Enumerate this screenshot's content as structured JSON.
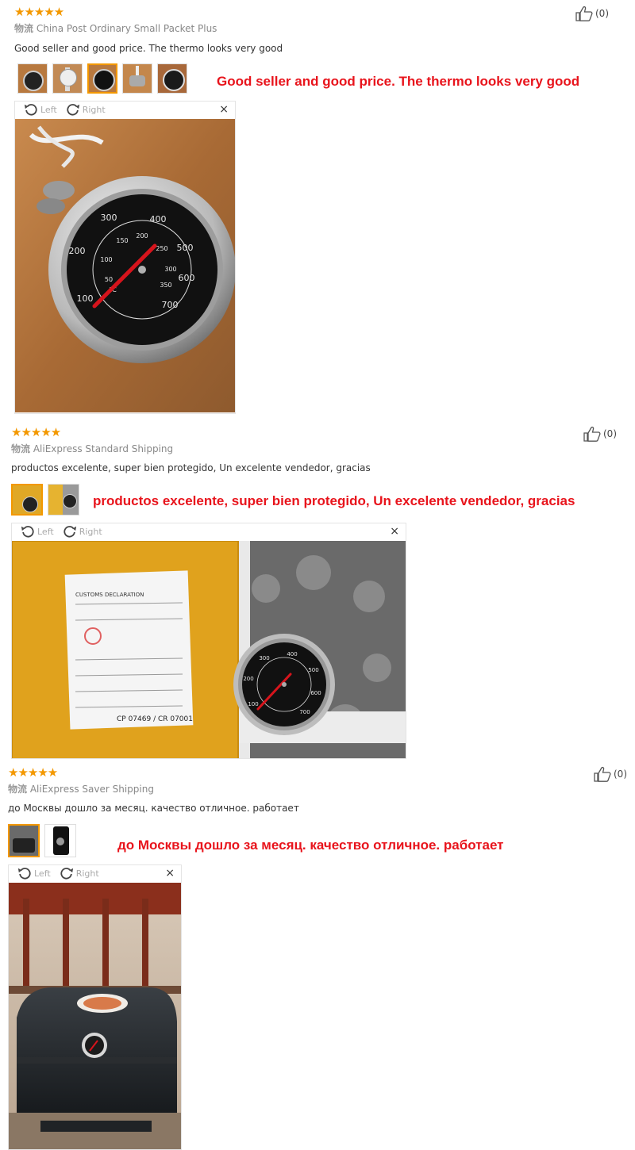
{
  "reviews": [
    {
      "stars": "★★★★★",
      "helpful": "(0)",
      "shipping_label": "物流",
      "shipping": "China Post Ordinary Small Packet Plus",
      "text": "Good seller and good price. The thermo looks very good",
      "caption": "Good seller and good price. The thermo looks very good",
      "viewer": {
        "left": "Left",
        "right": "Right",
        "close": "×"
      }
    },
    {
      "stars": "★★★★★",
      "helpful": "(0)",
      "shipping_label": "物流",
      "shipping": "AliExpress Standard Shipping",
      "text": "productos excelente, super bien protegido, Un excelente vendedor, gracias",
      "caption": "productos excelente, super bien protegido, Un excelente vendedor, gracias",
      "viewer": {
        "left": "Left",
        "right": "Right",
        "close": "×"
      }
    },
    {
      "stars": "★★★★★",
      "helpful": "(0)",
      "shipping_label": "物流",
      "shipping": "AliExpress Saver Shipping",
      "text": "до Москвы дошло за месяц. качество отличное. работает",
      "caption": "до Москвы дошло за месяц. качество отличное. работает",
      "viewer": {
        "left": "Left",
        "right": "Right",
        "close": "×"
      }
    }
  ],
  "gauge_labels": {
    "outer": [
      "100",
      "200",
      "300",
      "400",
      "500",
      "600",
      "700"
    ],
    "inner": [
      "50",
      "100",
      "150",
      "200",
      "250",
      "300",
      "350"
    ],
    "unit": "°C"
  },
  "package": {
    "title": "CUSTOMS DECLARATION",
    "codes": "CP 07469 / CR 07001"
  },
  "colors": {
    "star": "#f39800",
    "caption": "#e8141c",
    "needle": "#d6141c"
  }
}
